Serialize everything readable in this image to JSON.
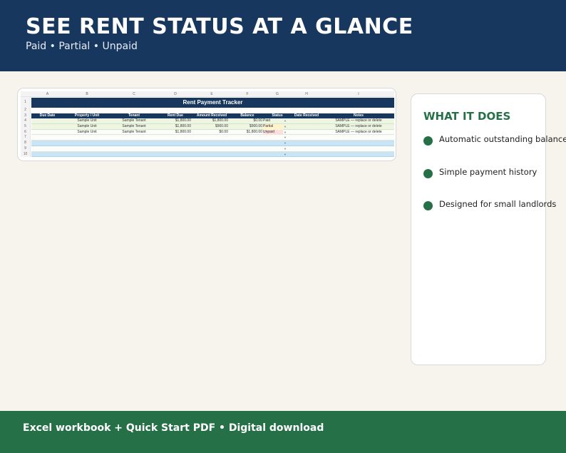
{
  "hero": {
    "title": "SEE RENT STATUS AT A GLANCE",
    "subtitle": "Paid • Partial • Unpaid"
  },
  "spreadsheet": {
    "column_letters": [
      "A",
      "B",
      "C",
      "D",
      "E",
      "F",
      "G",
      "H",
      "I"
    ],
    "title": "Rent Payment Tracker",
    "headers": [
      "Due Date",
      "Property / Unit",
      "Tenant",
      "Rent Due",
      "Amount Received",
      "Balance",
      "Status",
      "Date Received",
      "Notes"
    ],
    "rows": [
      {
        "num": "4",
        "unit": "Sample Unit",
        "tenant": "Sample Tenant",
        "rent": "$1,800.00",
        "received": "$1,800.00",
        "balance": "$0.00",
        "status": "Paid",
        "notes": "SAMPLE — replace or delete"
      },
      {
        "num": "5",
        "unit": "Sample Unit",
        "tenant": "Sample Tenant",
        "rent": "$1,800.00",
        "received": "$900.00",
        "balance": "$900.00",
        "status": "Partial",
        "notes": "SAMPLE — replace or delete"
      },
      {
        "num": "6",
        "unit": "Sample Unit",
        "tenant": "Sample Tenant",
        "rent": "$1,800.00",
        "received": "$0.00",
        "balance": "$1,800.00",
        "status": "Unpaid",
        "notes": "SAMPLE — replace or delete"
      }
    ],
    "row_numbers": [
      "1",
      "2",
      "3",
      "4",
      "5",
      "6",
      "7",
      "8",
      "9",
      "10"
    ],
    "dropdown_glyph": "▼"
  },
  "side_panel": {
    "title": "WHAT IT DOES",
    "features": [
      "Automatic outstanding balance",
      "Simple payment history",
      "Designed for small landlords"
    ]
  },
  "footer": {
    "text": "Excel workbook + Quick Start PDF  •  Digital download"
  },
  "colors": {
    "navy": "#17375e",
    "green": "#267048",
    "background": "#f7f4ee",
    "paid_row": "#eef6e3",
    "empty_row": "#c9e4f4"
  }
}
